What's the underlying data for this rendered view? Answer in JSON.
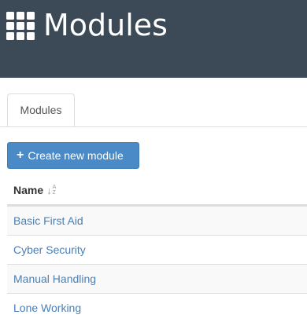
{
  "header": {
    "title": "Modules",
    "icon": "grid-icon"
  },
  "tabs": [
    {
      "label": "Modules",
      "active": true
    }
  ],
  "toolbar": {
    "create_label": "Create new module",
    "create_icon": "plus-icon",
    "create_color": "#4a8bc7"
  },
  "table": {
    "columns": [
      {
        "label": "Name",
        "sort": "ascending"
      }
    ],
    "sort_icon_letters": {
      "top": "A",
      "bottom": "Z"
    },
    "rows": [
      {
        "name": "Basic First Aid"
      },
      {
        "name": "Cyber Security"
      },
      {
        "name": "Manual Handling"
      },
      {
        "name": "Lone Working"
      }
    ]
  },
  "colors": {
    "header_bg": "#3b4a56",
    "link": "#4a7fb5"
  }
}
